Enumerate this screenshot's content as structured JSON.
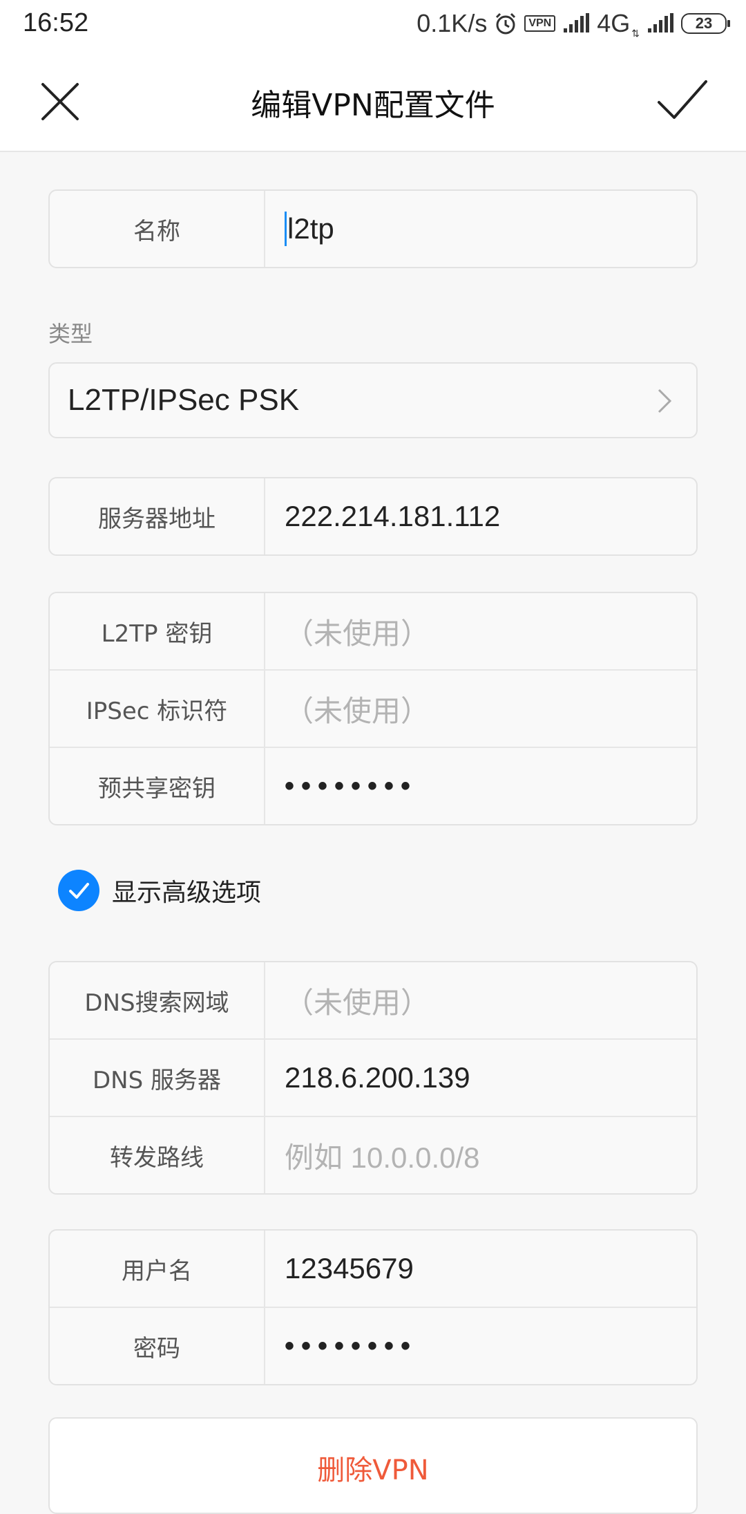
{
  "status_bar": {
    "time": "16:52",
    "net_speed": "0.1K/s",
    "vpn_badge": "VPN",
    "network": "4G",
    "battery": "23"
  },
  "title_bar": {
    "title": "编辑VPN配置文件",
    "close_icon": "close-icon",
    "confirm_icon": "checkmark-icon"
  },
  "name": {
    "label": "名称",
    "value": "l2tp"
  },
  "type": {
    "section_label": "类型",
    "value": "L2TP/IPSec PSK"
  },
  "server": {
    "label": "服务器地址",
    "value": "222.214.181.112"
  },
  "secrets": {
    "l2tp_secret": {
      "label": "L2TP 密钥",
      "placeholder": "（未使用）"
    },
    "ipsec_id": {
      "label": "IPSec 标识符",
      "placeholder": "（未使用）"
    },
    "psk": {
      "label": "预共享密钥",
      "value": "••••••••"
    }
  },
  "advanced": {
    "label": "显示高级选项",
    "checked": true,
    "accent": "#0d84ff"
  },
  "dns": {
    "search_domain": {
      "label": "DNS搜索网域",
      "placeholder": "（未使用）"
    },
    "server": {
      "label": "DNS 服务器",
      "value": "218.6.200.139"
    },
    "routes": {
      "label": "转发路线",
      "placeholder": "例如 10.0.0.0/8"
    }
  },
  "account": {
    "username": {
      "label": "用户名",
      "value": "12345679"
    },
    "password": {
      "label": "密码",
      "value": "••••••••"
    }
  },
  "delete_button": {
    "label": "删除VPN",
    "color": "#ef5a3a"
  }
}
